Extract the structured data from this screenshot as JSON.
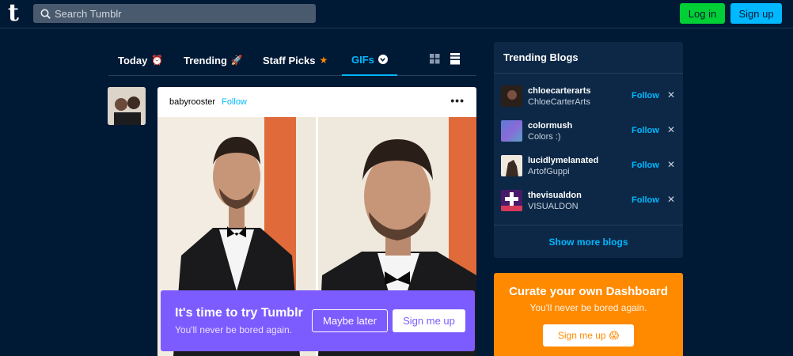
{
  "header": {
    "logo": "t",
    "search_placeholder": "Search Tumblr",
    "login_label": "Log in",
    "signup_label": "Sign up"
  },
  "tabs": [
    {
      "label": "Today",
      "icon": "⏰"
    },
    {
      "label": "Trending",
      "icon": "🚀"
    },
    {
      "label": "Staff Picks",
      "icon": "★"
    },
    {
      "label": "GIFs",
      "icon": "chevron-down-icon"
    }
  ],
  "post": {
    "username": "babyrooster",
    "follow_label": "Follow",
    "more_label": "•••"
  },
  "promo": {
    "title": "It's time to try Tumblr",
    "subtitle": "You'll never be bored again.",
    "later_label": "Maybe later",
    "signup_label": "Sign me up"
  },
  "trending": {
    "title": "Trending Blogs",
    "blogs": [
      {
        "name": "chloecarterarts",
        "title": "ChloeCarterArts",
        "follow": "Follow",
        "close": "✕"
      },
      {
        "name": "colormush",
        "title": "Colors :)",
        "follow": "Follow",
        "close": "✕"
      },
      {
        "name": "lucidlymelanated",
        "title": "ArtofGuppi",
        "follow": "Follow",
        "close": "✕"
      },
      {
        "name": "thevisualdon",
        "title": "VISUALDON",
        "follow": "Follow",
        "close": "✕"
      }
    ],
    "show_more": "Show more blogs"
  },
  "curate": {
    "title": "Curate your own Dashboard",
    "subtitle": "You'll never be bored again.",
    "button_label": "Sign me up",
    "button_emoji": "😱"
  },
  "colors": {
    "background": "#001935",
    "accent_blue": "#00b8ff",
    "login_green": "#00cf35",
    "promo_purple": "#7c5cff",
    "curate_orange": "#ff8a00"
  }
}
